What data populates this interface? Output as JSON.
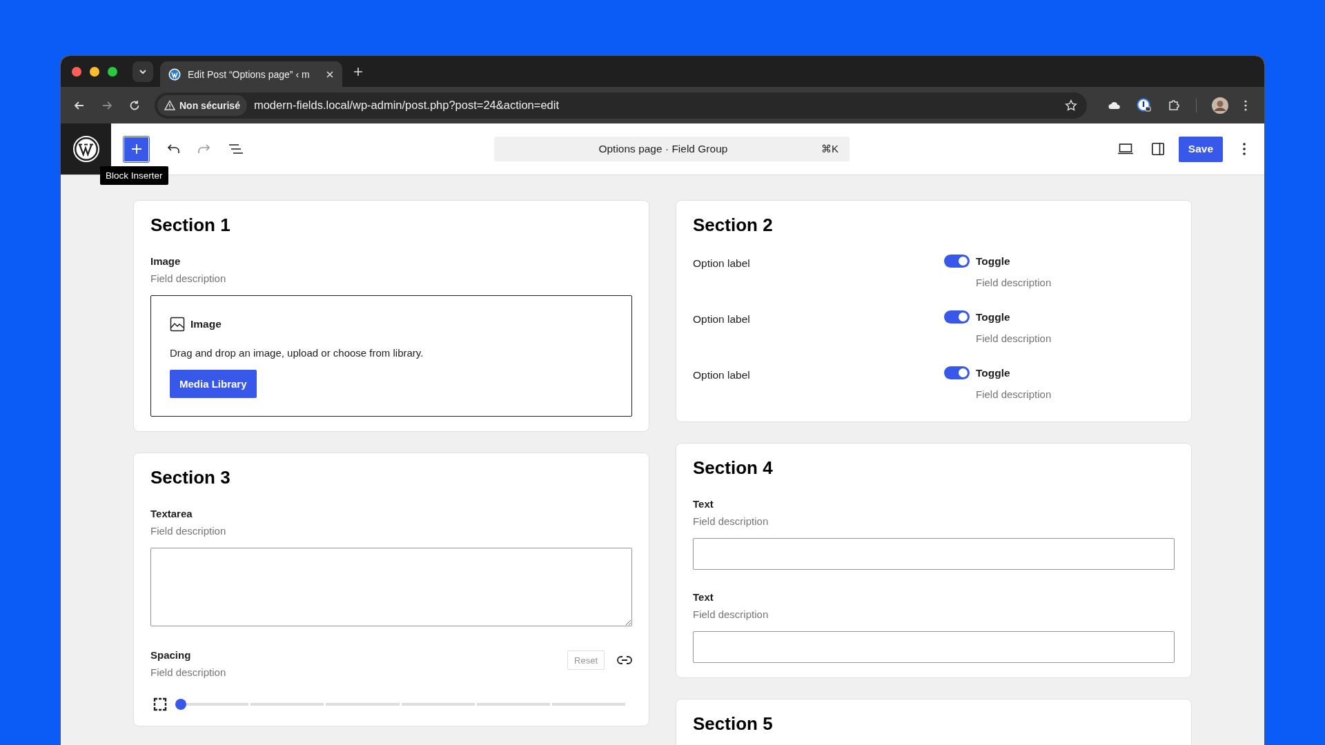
{
  "browser": {
    "tab": {
      "title": "Edit Post “Options page” ‹ m"
    },
    "security_label": "Non sécurisé",
    "url": "modern-fields.local/wp-admin/post.php?post=24&action=edit"
  },
  "editor_toolbar": {
    "tooltip": "Block Inserter",
    "command": "Options page · Field Group",
    "shortcut": "⌘K",
    "save": "Save"
  },
  "columns": [
    [
      {
        "title": "Section 1",
        "fields": [
          {
            "kind": "image",
            "label": "Image",
            "description": "Field description",
            "title": "Image",
            "instructions": "Drag and drop an image, upload or choose from library.",
            "button": "Media Library"
          }
        ]
      },
      {
        "title": "Section 3",
        "fields": [
          {
            "kind": "textarea",
            "label": "Textarea",
            "description": "Field description"
          },
          {
            "kind": "spacing",
            "label": "Spacing",
            "description": "Field description",
            "reset": "Reset",
            "level": 0
          }
        ]
      }
    ],
    [
      {
        "title": "Section 2",
        "fields": [
          {
            "kind": "toggle",
            "label": "Option label",
            "toggle_label": "Toggle",
            "description": "Field description",
            "on": true
          },
          {
            "kind": "toggle",
            "label": "Option label",
            "toggle_label": "Toggle",
            "description": "Field description",
            "on": true
          },
          {
            "kind": "toggle",
            "label": "Option label",
            "toggle_label": "Toggle",
            "description": "Field description",
            "on": true
          }
        ]
      },
      {
        "title": "Section 4",
        "fields": [
          {
            "kind": "text",
            "label": "Text",
            "description": "Field description"
          },
          {
            "kind": "text",
            "label": "Text",
            "description": "Field description"
          }
        ]
      },
      {
        "title": "Section 5"
      }
    ]
  ]
}
